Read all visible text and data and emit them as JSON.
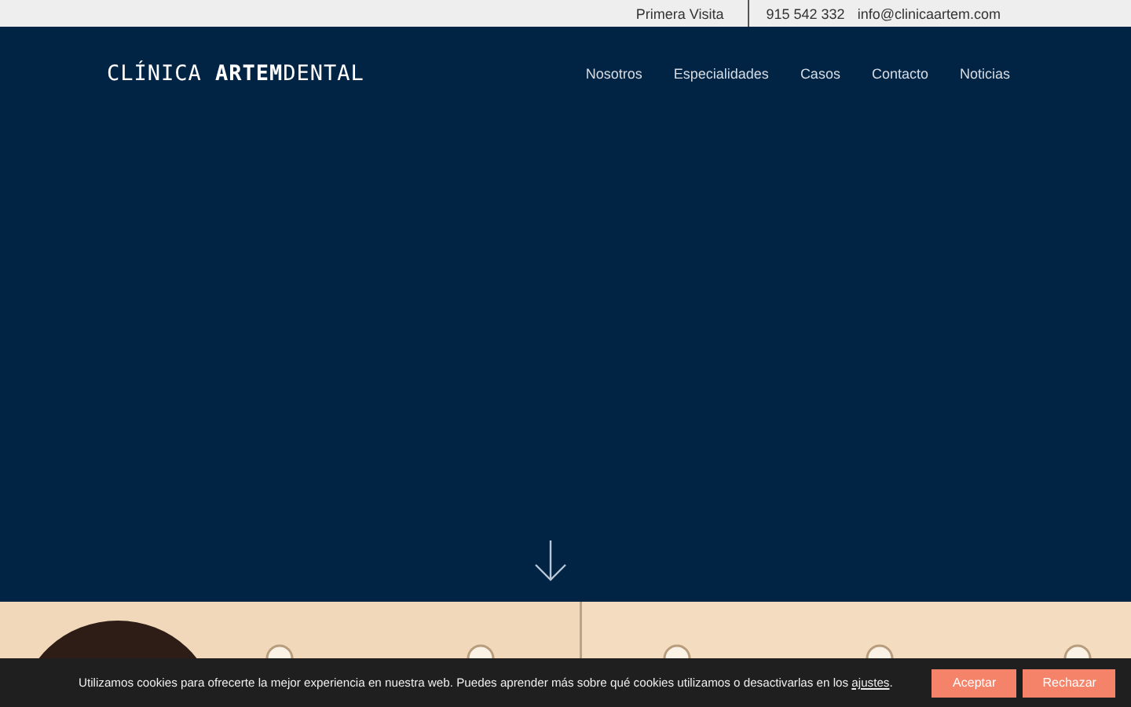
{
  "top_bar": {
    "links": [
      "Primera Visita"
    ],
    "phone": "915 542 332",
    "email": "info@clinicaartem.com"
  },
  "header": {
    "logo": "CLÍNICA **ARTEM**DENTAL",
    "nav": [
      "Nosotros",
      "Especialidades",
      "Casos",
      "Contacto",
      "Noticias"
    ]
  },
  "cookie_bar": {
    "text": "Utilizamos cookies para ofrecerte la mejor experiencia en nuestra web. Puedes aprender más sobre qué cookies utilizamos o desactivarlas en los ",
    "link": "ajustes",
    "text_end": ".",
    "buttons": [
      "Aceptar",
      "Rechazar"
    ]
  }
}
